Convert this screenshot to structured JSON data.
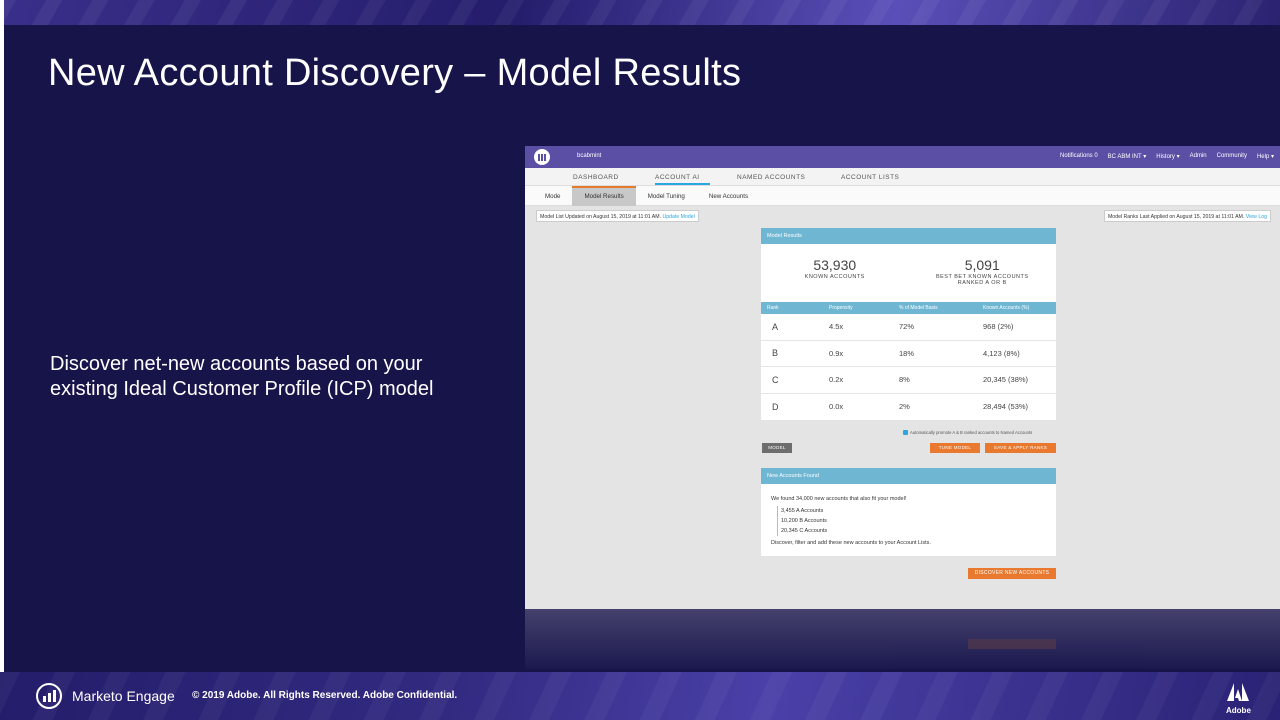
{
  "slide": {
    "title": "New Account Discovery – Model Results",
    "body": "Discover net-new accounts based on your existing Ideal Customer Profile (ICP) model"
  },
  "footer": {
    "brand": "Marketo Engage",
    "copyright": "© 2019 Adobe.  All Rights Reserved.  Adobe Confidential.",
    "adobe": "Adobe"
  },
  "app": {
    "user": "bcabmint",
    "topnav": [
      "Notifications 0",
      "BC ABM INT ▾",
      "History ▾",
      "Admin",
      "Community",
      "Help ▾"
    ],
    "tabs": [
      "DASHBOARD",
      "ACCOUNT AI",
      "NAMED ACCOUNTS",
      "ACCOUNT LISTS"
    ],
    "subtabs": [
      "Mode",
      "Model Results",
      "Model Tuning",
      "New Accounts"
    ],
    "note_left": {
      "text": "Model List Updated on August 15, 2019 at 11:01 AM.",
      "link": "Update Model"
    },
    "note_right": {
      "text": "Model Ranks Last Applied on August 15, 2019 at 11:01 AM.",
      "link": "View Log"
    },
    "results": {
      "header": "Model Results",
      "known_value": "53,930",
      "known_label": "KNOWN ACCOUNTS",
      "best_value": "5,091",
      "best_label": "BEST BET KNOWN ACCOUNTS RANKED A OR B",
      "columns": [
        "Rank",
        "Propensity",
        "% of Model Basis",
        "Known Accounts (%)"
      ],
      "rows": [
        {
          "rank": "A",
          "propensity": "4.5x",
          "basis": "72%",
          "known": "968 (2%)"
        },
        {
          "rank": "B",
          "propensity": "0.9x",
          "basis": "18%",
          "known": "4,123 (8%)"
        },
        {
          "rank": "C",
          "propensity": "0.2x",
          "basis": "8%",
          "known": "20,345 (38%)"
        },
        {
          "rank": "D",
          "propensity": "0.0x",
          "basis": "2%",
          "known": "28,494 (53%)"
        }
      ]
    },
    "auto_promote": "Automatically promote A & B ranked accounts to Named Accounts",
    "buttons": {
      "model": "MODEL",
      "tune": "TUNE MODEL",
      "save": "SAVE & APPLY RANKS",
      "discover": "DISCOVER NEW ACCOUNTS"
    },
    "found": {
      "header": "New Accounts Found",
      "intro": "We found 34,000 new accounts that also fit your model!",
      "items": [
        "3,455 A Accounts",
        "10,200 B Accounts",
        "20,345 C Accounts"
      ],
      "outro": "Discover, filter and add these new accounts to your Account Lists."
    }
  },
  "colors": {
    "slide_bg": "#17144a",
    "app_header": "#5b4ea5",
    "table_header": "#6fb6d3",
    "accent_orange": "#e8792f",
    "link_blue": "#2aa6e0"
  }
}
